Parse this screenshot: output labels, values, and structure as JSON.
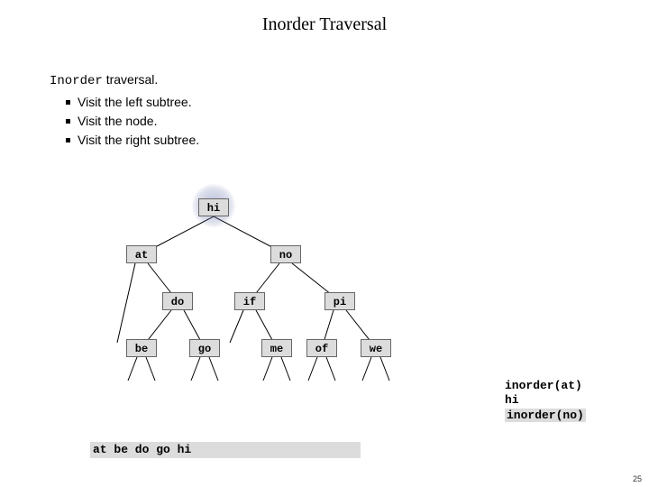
{
  "title": "Inorder Traversal",
  "heading_prefix_mono": "Inorder",
  "heading_suffix": " traversal.",
  "bullets": [
    "Visit the left subtree.",
    "Visit the node.",
    "Visit the right subtree."
  ],
  "tree": {
    "highlighted": "hi",
    "nodes": {
      "hi": "hi",
      "at": "at",
      "no": "no",
      "do": "do",
      "if": "if",
      "pi": "pi",
      "be": "be",
      "go": "go",
      "me": "me",
      "of": "of",
      "we": "we"
    }
  },
  "calltrace": {
    "line1": "inorder(at)",
    "line2": "hi",
    "line3": "inorder(no)"
  },
  "output_sequence": "at be do go hi",
  "page_number": "25"
}
